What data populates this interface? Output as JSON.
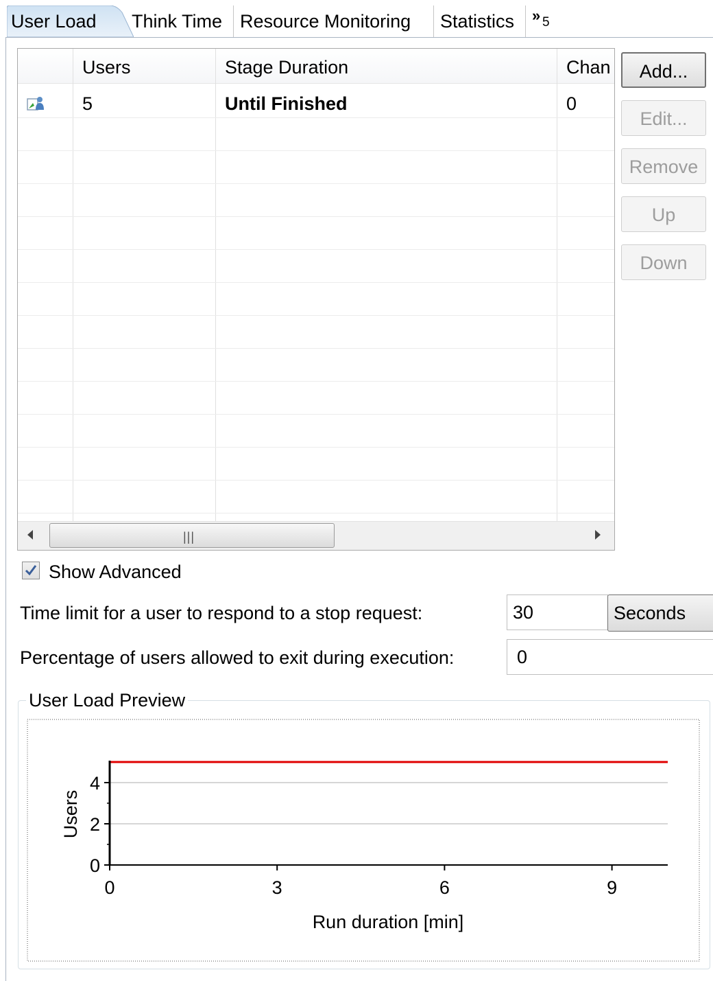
{
  "tabs": [
    {
      "label": "User Load",
      "active": true
    },
    {
      "label": "Think Time",
      "active": false
    },
    {
      "label": "Resource Monitoring",
      "active": false
    },
    {
      "label": "Statistics",
      "active": false
    }
  ],
  "tab_overflow": {
    "count": "5"
  },
  "table": {
    "columns": [
      "Users",
      "Stage Duration",
      "Chan"
    ],
    "rows": [
      {
        "users": "5",
        "stage_duration": "Until Finished",
        "change": "0"
      }
    ]
  },
  "buttons": {
    "add": "Add...",
    "edit": "Edit...",
    "remove": "Remove",
    "up": "Up",
    "down": "Down"
  },
  "advanced": {
    "show_advanced_label": "Show Advanced",
    "show_advanced_checked": true,
    "time_limit_label": "Time limit for a user to respond to a stop request:",
    "time_limit_value": "30",
    "time_limit_unit": "Seconds",
    "exit_pct_label": "Percentage of users allowed to exit during execution:",
    "exit_pct_value": "0"
  },
  "preview": {
    "group_title": "User Load Preview"
  },
  "chart_data": {
    "type": "line",
    "xlabel": "Run duration [min]",
    "ylabel": "Users",
    "x_ticks": [
      "0",
      "3",
      "6",
      "9"
    ],
    "y_ticks": [
      "0",
      "2",
      "4"
    ],
    "xlim": [
      0,
      10
    ],
    "ylim": [
      0,
      5
    ],
    "grid": true,
    "series": [
      {
        "color": "#e00000",
        "x": [
          0,
          10
        ],
        "y": [
          5,
          5
        ]
      }
    ]
  }
}
